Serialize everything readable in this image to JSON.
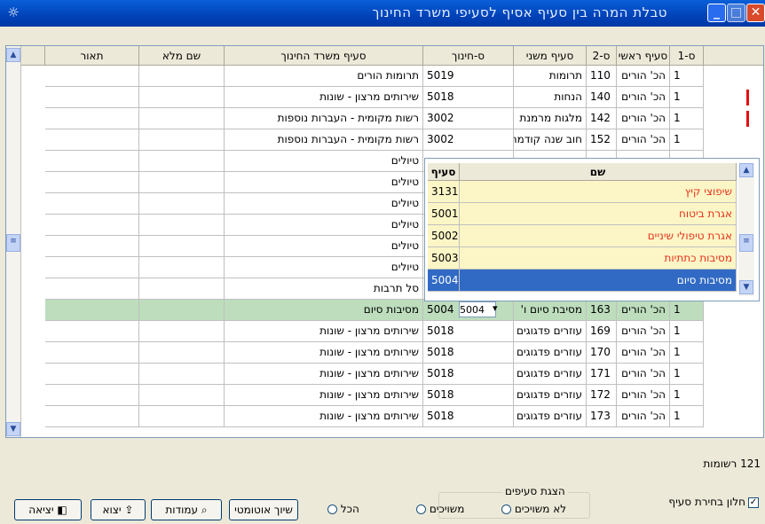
{
  "window": {
    "title": "טבלת המרה בין סעיף אסיף לסעיפי משרד החינוך"
  },
  "columns": [
    "ס-1",
    "סעיף ראשי",
    "ס-2",
    "סעיף משני",
    "ס-חינוך",
    "סעיף משרד החינוך",
    "שם מלא",
    "תאור"
  ],
  "rows": [
    {
      "s1": "1",
      "main": "הכ' הורים",
      "s2": "110",
      "sub": "תרומות",
      "edu": "5019",
      "edu_name": "תרומות הורים",
      "full": "",
      "desc": ""
    },
    {
      "s1": "1",
      "main": "הכ' הורים",
      "s2": "140",
      "sub": "הנחות",
      "edu": "5018",
      "edu_name": "שירותים מרצון - שונות",
      "full": "",
      "desc": ""
    },
    {
      "s1": "1",
      "main": "הכ' הורים",
      "s2": "142",
      "sub": "מלגות מרמנת",
      "edu": "3002",
      "edu_name": "רשות מקומית - העברות נוספות",
      "full": "",
      "desc": ""
    },
    {
      "s1": "1",
      "main": "הכ' הורים",
      "s2": "152",
      "sub": "חוב שנה קודמת",
      "edu": "3002",
      "edu_name": "רשות מקומית - העברות נוספות",
      "full": "",
      "desc": ""
    },
    {
      "s1": "",
      "main": "",
      "s2": "",
      "sub": "",
      "edu": "",
      "edu_name": "טיולים",
      "full": "",
      "desc": ""
    },
    {
      "s1": "",
      "main": "",
      "s2": "",
      "sub": "",
      "edu": "",
      "edu_name": "טיולים",
      "full": "",
      "desc": ""
    },
    {
      "s1": "",
      "main": "",
      "s2": "",
      "sub": "",
      "edu": "",
      "edu_name": "טיולים",
      "full": "",
      "desc": ""
    },
    {
      "s1": "",
      "main": "",
      "s2": "",
      "sub": "",
      "edu": "",
      "edu_name": "טיולים",
      "full": "",
      "desc": ""
    },
    {
      "s1": "",
      "main": "",
      "s2": "",
      "sub": "",
      "edu": "",
      "edu_name": "טיולים",
      "full": "",
      "desc": ""
    },
    {
      "s1": "",
      "main": "",
      "s2": "",
      "sub": "",
      "edu": "",
      "edu_name": "טיולים",
      "full": "",
      "desc": ""
    },
    {
      "s1": "",
      "main": "",
      "s2": "",
      "sub": "",
      "edu": "",
      "edu_name": "סל תרבות",
      "full": "",
      "desc": ""
    },
    {
      "s1": "1",
      "main": "הכ' הורים",
      "s2": "163",
      "sub": "מסיבת סיום ו'",
      "edu": "5004",
      "edu_name": "מסיבות סיום",
      "full": "",
      "desc": ""
    },
    {
      "s1": "1",
      "main": "הכ' הורים",
      "s2": "169",
      "sub": "עוזרים פדגוגים א",
      "edu": "5018",
      "edu_name": "שירותים מרצון - שונות",
      "full": "",
      "desc": ""
    },
    {
      "s1": "1",
      "main": "הכ' הורים",
      "s2": "170",
      "sub": "עוזרים פדגוגים ב",
      "edu": "5018",
      "edu_name": "שירותים מרצון - שונות",
      "full": "",
      "desc": ""
    },
    {
      "s1": "1",
      "main": "הכ' הורים",
      "s2": "171",
      "sub": "עוזרים פדגוגים ג",
      "edu": "5018",
      "edu_name": "שירותים מרצון - שונות",
      "full": "",
      "desc": ""
    },
    {
      "s1": "1",
      "main": "הכ' הורים",
      "s2": "172",
      "sub": "עוזרים פדגוגים ד",
      "edu": "5018",
      "edu_name": "שירותים מרצון - שונות",
      "full": "",
      "desc": ""
    },
    {
      "s1": "1",
      "main": "הכ' הורים",
      "s2": "173",
      "sub": "עוזרים פדגוגים ה",
      "edu": "5018",
      "edu_name": "שירותים מרצון - שונות",
      "full": "",
      "desc": ""
    }
  ],
  "dropdown": {
    "headers": [
      "סעיף",
      "שם"
    ],
    "items": [
      {
        "code": "3131",
        "name": "שיפוצי קיץ"
      },
      {
        "code": "5001",
        "name": "אגרת ביטוח"
      },
      {
        "code": "5002",
        "name": "אגרת טיפולי שיניים"
      },
      {
        "code": "5003",
        "name": "מסיבות כתתיות"
      },
      {
        "code": "5004",
        "name": "מסיבות סיום"
      }
    ],
    "current_value": "5004"
  },
  "status": {
    "count": "121 רשומות"
  },
  "footer": {
    "exit_label": "יציאה",
    "export_label": "יצוא",
    "columns_label": "עמודות",
    "auto_label": "שיוך אוטומטי",
    "group_label": "הצגת סעיפים",
    "radio_all": "הכל",
    "radio_linked": "משויכים",
    "radio_unlinked": "לא משויכים",
    "checkbox_label": "חלון בחירת סעיף"
  }
}
